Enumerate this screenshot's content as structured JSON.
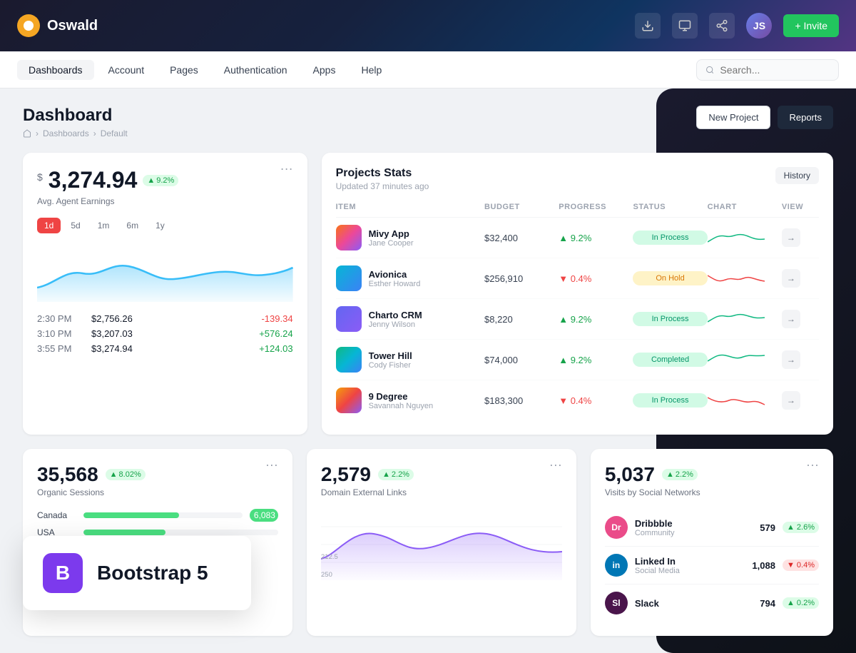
{
  "app": {
    "logo_text": "Oswald",
    "invite_label": "+ Invite"
  },
  "nav": {
    "items": [
      {
        "label": "Dashboards",
        "active": true
      },
      {
        "label": "Account",
        "active": false
      },
      {
        "label": "Pages",
        "active": false
      },
      {
        "label": "Authentication",
        "active": false
      },
      {
        "label": "Apps",
        "active": false
      },
      {
        "label": "Help",
        "active": false
      }
    ],
    "search_placeholder": "Search..."
  },
  "page": {
    "title": "Dashboard",
    "breadcrumb": [
      "home",
      "Dashboards",
      "Default"
    ],
    "new_project_label": "New Project",
    "reports_label": "Reports"
  },
  "earnings": {
    "currency": "$",
    "amount": "3,274.94",
    "badge": "9.2%",
    "subtitle": "Avg. Agent Earnings",
    "more": "...",
    "time_filters": [
      "1d",
      "5d",
      "1m",
      "6m",
      "1y"
    ],
    "active_filter": "1d",
    "rows": [
      {
        "time": "2:30 PM",
        "amount": "$2,756.26",
        "change": "-139.34",
        "positive": false
      },
      {
        "time": "3:10 PM",
        "amount": "$3,207.03",
        "change": "+576.24",
        "positive": true
      },
      {
        "time": "3:55 PM",
        "amount": "$3,274.94",
        "change": "+124.03",
        "positive": true
      }
    ]
  },
  "projects": {
    "title": "Projects Stats",
    "subtitle": "Updated 37 minutes ago",
    "history_label": "History",
    "columns": [
      "ITEM",
      "BUDGET",
      "PROGRESS",
      "STATUS",
      "CHART",
      "VIEW"
    ],
    "rows": [
      {
        "name": "Mivy App",
        "person": "Jane Cooper",
        "budget": "$32,400",
        "progress": "9.2%",
        "progress_up": true,
        "status": "In Process",
        "status_type": "process",
        "color": "green"
      },
      {
        "name": "Avionica",
        "person": "Esther Howard",
        "budget": "$256,910",
        "progress": "0.4%",
        "progress_up": false,
        "status": "On Hold",
        "status_type": "hold",
        "color": "red"
      },
      {
        "name": "Charto CRM",
        "person": "Jenny Wilson",
        "budget": "$8,220",
        "progress": "9.2%",
        "progress_up": true,
        "status": "In Process",
        "status_type": "process",
        "color": "green"
      },
      {
        "name": "Tower Hill",
        "person": "Cody Fisher",
        "budget": "$74,000",
        "progress": "9.2%",
        "progress_up": true,
        "status": "Completed",
        "status_type": "completed",
        "color": "green"
      },
      {
        "name": "9 Degree",
        "person": "Savannah Nguyen",
        "budget": "$183,300",
        "progress": "0.4%",
        "progress_up": false,
        "status": "In Process",
        "status_type": "process",
        "color": "red"
      }
    ]
  },
  "sessions": {
    "count": "35,568",
    "badge": "8.02%",
    "label": "Organic Sessions",
    "more": "...",
    "bars": [
      {
        "label": "Canada",
        "value": 6083,
        "max": 10000,
        "color": "#4ade80"
      },
      {
        "label": "USA",
        "value": 4200,
        "max": 10000,
        "color": "#4ade80"
      }
    ]
  },
  "domain": {
    "count": "2,579",
    "badge": "2.2%",
    "label": "Domain External Links",
    "more": "..."
  },
  "social": {
    "count": "5,037",
    "badge": "2.2%",
    "label": "Visits by Social Networks",
    "networks": [
      {
        "name": "Dribbble",
        "type": "Community",
        "count": "579",
        "change": "2.6%",
        "positive": true,
        "color": "#ea4c89"
      },
      {
        "name": "Linked In",
        "type": "Social Media",
        "count": "1,088",
        "change": "0.4%",
        "positive": false,
        "color": "#0077b5"
      },
      {
        "name": "Slack",
        "type": "",
        "count": "794",
        "change": "0.2%",
        "positive": true,
        "color": "#4a154b"
      }
    ]
  },
  "bootstrap": {
    "icon": "B",
    "text": "Bootstrap 5"
  }
}
